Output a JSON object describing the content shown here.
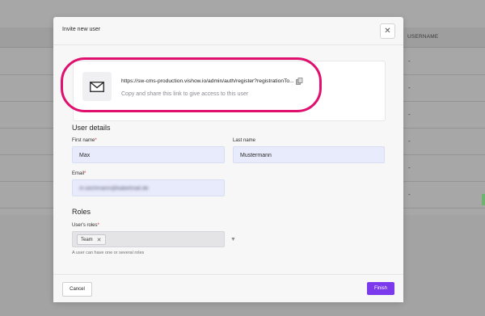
{
  "background": {
    "column_header": "USERNAME",
    "row_dash": "-"
  },
  "modal": {
    "title": "Invite new user",
    "close_icon": "close-icon",
    "invite_link": {
      "url": "https://sw-cms-production.vishow.io/admin/auth/register?registrationTo...",
      "help": "Copy and share this link to give access to this user"
    },
    "user_details": {
      "title": "User details",
      "first_name_label": "First name",
      "first_name_value": "Max",
      "last_name_label": "Last name",
      "last_name_value": "Mustermann",
      "email_label": "Email",
      "email_value": "m.wichmann@kabelmail.de"
    },
    "roles": {
      "title": "Roles",
      "label": "User's roles",
      "selected": "Team",
      "hint": "A user can have one or several roles"
    },
    "footer": {
      "cancel": "Cancel",
      "finish": "Finish"
    }
  },
  "colors": {
    "highlight": "#e0106e",
    "primary": "#7c3aed",
    "input_bg": "#e8ebfb"
  }
}
